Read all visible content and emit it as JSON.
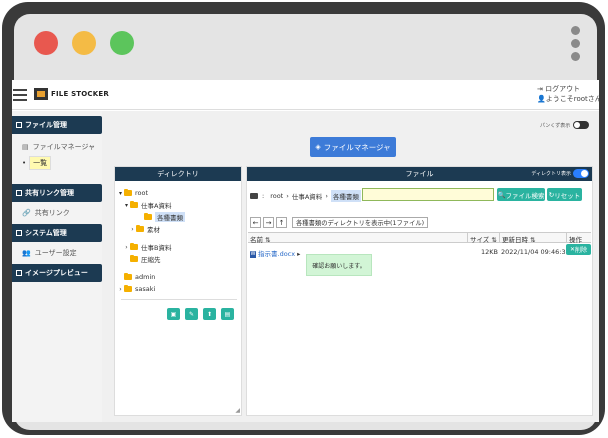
{
  "topbar": {
    "logo_text": "FILE STOCKER",
    "logout_label": "ログアウト",
    "welcome_text": "ようこそrootさん"
  },
  "sidebar": {
    "sections": [
      {
        "title": "ファイル管理"
      },
      {
        "title": "共有リンク管理"
      },
      {
        "title": "システム管理"
      },
      {
        "title": "イメージプレビュー"
      }
    ],
    "file_manager_item": "ファイルマネージャ",
    "file_manager_sub": "一覧",
    "share_link_item": "共有リンク",
    "user_settings_item": "ユーザー設定"
  },
  "main": {
    "panel_display_label": "パンくず表示",
    "file_manager_button": "ファイルマネージャ"
  },
  "directory": {
    "title": "ディレクトリ",
    "tree": [
      {
        "label": "root",
        "caret": "▾"
      },
      {
        "label": "仕事A資料",
        "caret": "▾"
      },
      {
        "label": "各種書類",
        "caret": "",
        "selected": true
      },
      {
        "label": "素材",
        "caret": "›"
      },
      {
        "label": "仕事B資料",
        "caret": "›"
      },
      {
        "label": "圧縮先",
        "caret": ""
      },
      {
        "label": "admin",
        "caret": ""
      },
      {
        "label": "sasaki",
        "caret": "›"
      }
    ]
  },
  "files": {
    "title": "ファイル",
    "dir_display_label": "ディレクトリ表示",
    "breadcrumb": [
      "root",
      "仕事A資料",
      "各種書類"
    ],
    "search_value": "",
    "search_button": "ファイル検索",
    "reset_button": "リセット",
    "nav_info": "各種書類のディレクトリを表示中(1ファイル)",
    "columns": {
      "name": "名前 ⇅",
      "size": "サイズ ⇅",
      "updated": "更新日時 ⇅",
      "action": "操作"
    },
    "rows": [
      {
        "name": "指示書.docx",
        "size": "12KB",
        "updated": "2022/11/04 09:46:30",
        "action": "削除"
      }
    ],
    "tooltip": "確認お願いします。"
  },
  "colors": {
    "nav_dark": "#1c3a52",
    "accent_blue": "#3d7bd8",
    "teal": "#2ab3a0",
    "folder_yellow": "#f5b000"
  }
}
